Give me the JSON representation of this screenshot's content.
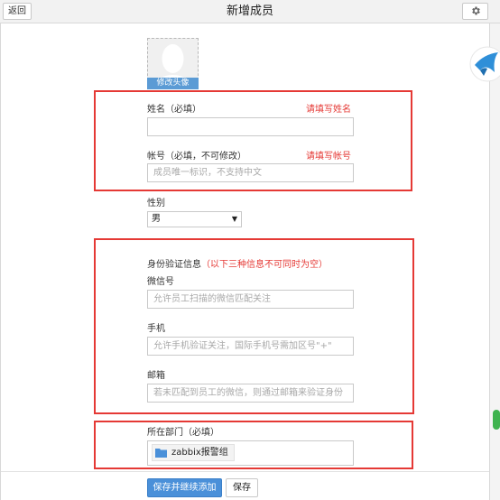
{
  "header": {
    "back_label": "返回",
    "title": "新增成员",
    "settings_icon": "gear-icon"
  },
  "avatar": {
    "edit_label": "修改头像"
  },
  "name_field": {
    "label": "姓名（必填）",
    "error": "请填写姓名",
    "value": "",
    "placeholder": ""
  },
  "account_field": {
    "label": "帐号（必填，不可修改）",
    "error": "请填写帐号",
    "placeholder": "成员唯一标识，不支持中文"
  },
  "gender": {
    "label": "性别",
    "selected": "男"
  },
  "identity": {
    "title": "身份验证信息",
    "note": "（以下三种信息不可同时为空）",
    "wechat": {
      "label": "微信号",
      "placeholder": "允许员工扫描的微信匹配关注"
    },
    "phone": {
      "label": "手机",
      "placeholder": "允许手机验证关注，国际手机号需加区号\"+\""
    },
    "email": {
      "label": "邮箱",
      "placeholder": "若未匹配到员工的微信，则通过邮箱来验证身份"
    }
  },
  "department": {
    "label": "所在部门（必填）",
    "selected": "zabbix报警组",
    "icon": "folder-icon"
  },
  "footer": {
    "save_continue_label": "保存并继续添加",
    "save_label": "保存"
  },
  "colors": {
    "accent": "#4a90d9",
    "error": "#e53935",
    "avatar_tag": "#5b9bd5"
  }
}
